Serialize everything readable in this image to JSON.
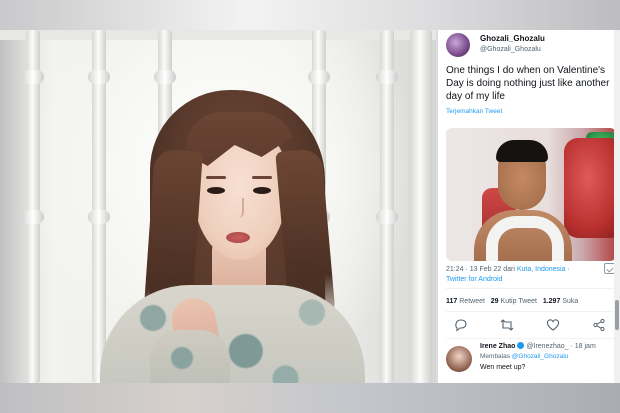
{
  "tweet": {
    "author_name": "Ghozali_Ghozalu",
    "author_handle": "@Ghozali_Ghozalu",
    "text": "One things I do when on Valentine's Day is doing nothing just like another day of my life",
    "translate_label": "Terjemahkan Tweet",
    "meta_time": "21:24 · 13 Feb 22 dari",
    "meta_location": "Kuta, Indonesia",
    "meta_separator": "·",
    "meta_source": "Twitter for Android",
    "retweet_count": "117",
    "retweet_label": "Retweet",
    "quote_count": "29",
    "quote_label": "Kutip Tweet",
    "like_count": "1.297",
    "like_label": "Suka"
  },
  "actions": {
    "reply_icon": "reply-icon",
    "retweet_icon": "retweet-icon",
    "like_icon": "heart-icon",
    "share_icon": "share-icon"
  },
  "reply": {
    "name": "Irene Zhao",
    "handle": "@Irenezhao_",
    "time": "· 18 jam",
    "replying_to_label": "Membalas",
    "replying_to_handle": "@Ghozali_Ghozalu",
    "text": "Wen meet up?"
  },
  "colors": {
    "link": "#1d9bf0",
    "text": "#0f1419",
    "muted": "#536471"
  }
}
